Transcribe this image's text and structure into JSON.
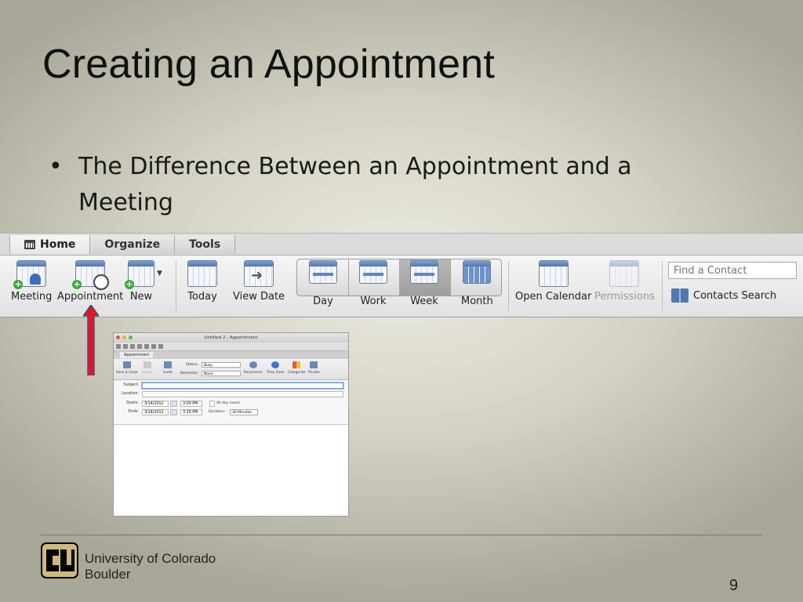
{
  "slide": {
    "title": "Creating an Appointment",
    "bullet": "The Difference Between an Appointment and a Meeting",
    "page_number": "9"
  },
  "ribbon": {
    "tabs": [
      {
        "label": "Home",
        "icon": "calendar-icon",
        "active": true
      },
      {
        "label": "Organize"
      },
      {
        "label": "Tools"
      }
    ],
    "buttons": {
      "meeting": "Meeting",
      "appointment": "Appointment",
      "new": "New",
      "today": "Today",
      "view_date": "View Date",
      "day": "Day",
      "work": "Work",
      "week": "Week",
      "month": "Month",
      "open_calendar": "Open Calendar",
      "permissions": "Permissions"
    },
    "find_contact_placeholder": "Find a Contact",
    "contacts_search": "Contacts Search",
    "selected_view": "Week"
  },
  "appointment_window": {
    "title": "Untitled 2 - Appointment",
    "tab": "Appointment",
    "buttons": {
      "save_close": "Save & Close",
      "delete": "Delete",
      "invite": "Invite",
      "recurrence": "Recurrence",
      "time_zone": "Time Zone",
      "categorize": "Categorize",
      "private": "Private"
    },
    "status_label": "Status:",
    "status_value": "Busy",
    "reminder_label": "Reminder:",
    "reminder_value": "None",
    "subject_label": "Subject:",
    "location_label": "Location:",
    "starts_label": "Starts:",
    "starts_date": "3/14/2012",
    "starts_time": "3:00 PM",
    "all_day_label": "All day event",
    "ends_label": "Ends:",
    "ends_date": "3/14/2012",
    "ends_time": "3:30 PM",
    "duration_label": "Duration:",
    "duration_value": "30 Minutes"
  },
  "footer": {
    "university_line1": "University of Colorado",
    "university_line2": "Boulder"
  },
  "colors": {
    "arrow": "#e8141b",
    "logo_gold": "#cfb87c",
    "logo_black": "#000000"
  }
}
